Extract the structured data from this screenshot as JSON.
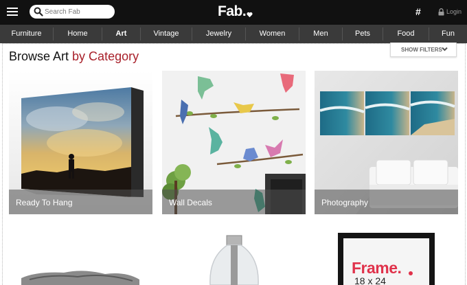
{
  "header": {
    "search_placeholder": "Search Fab",
    "logo": "Fab.",
    "hash_label": "#",
    "login_label": "Login",
    "logo_accent": "#e0324b"
  },
  "categories": [
    {
      "label": "Furniture",
      "active": false
    },
    {
      "label": "Home",
      "active": false
    },
    {
      "label": "Art",
      "active": true
    },
    {
      "label": "Vintage",
      "active": false
    },
    {
      "label": "Jewelry",
      "active": false
    },
    {
      "label": "Women",
      "active": false
    },
    {
      "label": "Men",
      "active": false
    },
    {
      "label": "Pets",
      "active": false
    },
    {
      "label": "Food",
      "active": false
    },
    {
      "label": "Fun",
      "active": false
    }
  ],
  "main": {
    "title_prefix": "Browse Art",
    "title_accent": "by Category",
    "accent_color": "#a8202a",
    "show_filters": "SHOW FILTERS"
  },
  "tiles": [
    {
      "label": "Ready To Hang"
    },
    {
      "label": "Wall Decals"
    },
    {
      "label": "Photography"
    }
  ],
  "row2": {
    "frame_text": "Frame.",
    "frame_sub": "18 x 24"
  }
}
